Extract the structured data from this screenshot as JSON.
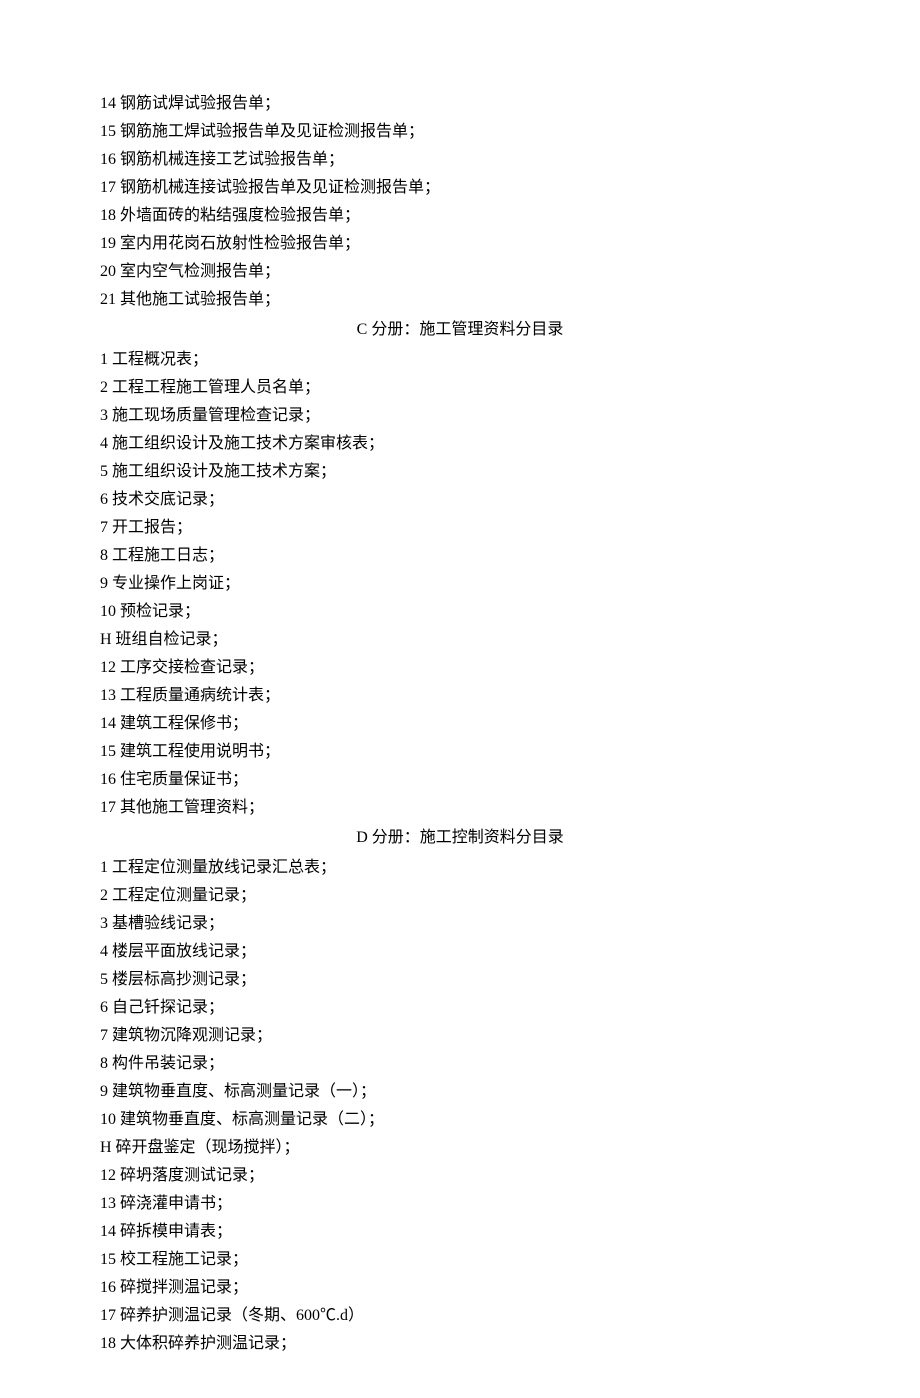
{
  "sectionB_tail": [
    "14 钢筋试焊试验报告单；",
    "15 钢筋施工焊试验报告单及见证检测报告单；",
    "16 钢筋机械连接工艺试验报告单；",
    "17 钢筋机械连接试验报告单及见证检测报告单；",
    "18 外墙面砖的粘结强度检验报告单；",
    "19 室内用花岗石放射性检验报告单；",
    "20 室内空气检测报告单；",
    "21 其他施工试验报告单；"
  ],
  "sectionC": {
    "header": "C 分册：施工管理资料分目录",
    "items": [
      "1 工程概况表；",
      "2 工程工程施工管理人员名单；",
      "3 施工现场质量管理检查记录；",
      "4 施工组织设计及施工技术方案审核表；",
      "5 施工组织设计及施工技术方案；",
      "6 技术交底记录；",
      "7 开工报告；",
      "8 工程施工日志；",
      "9 专业操作上岗证；",
      "10 预检记录；",
      "H 班组自检记录；",
      "12 工序交接检查记录；",
      "13 工程质量通病统计表；",
      "14 建筑工程保修书；",
      "15 建筑工程使用说明书；",
      "16 住宅质量保证书；",
      "17 其他施工管理资料；"
    ]
  },
  "sectionD": {
    "header": "D 分册：施工控制资料分目录",
    "items": [
      "1 工程定位测量放线记录汇总表；",
      "2 工程定位测量记录；",
      "3 基槽验线记录；",
      "4 楼层平面放线记录；",
      "5 楼层标高抄测记录；",
      "6 自己钎探记录；",
      "7 建筑物沉降观测记录；",
      "8 构件吊装记录；",
      "9 建筑物垂直度、标高测量记录（一）；",
      "10 建筑物垂直度、标高测量记录（二）；",
      "H 碎开盘鉴定（现场搅拌）；",
      "12 碎坍落度测试记录；",
      "13 碎浇灌申请书；",
      "14 碎拆模申请表；",
      "15 校工程施工记录；",
      "16 碎搅拌测温记录；",
      "17 碎养护测温记录（冬期、600℃.d）",
      "18 大体积碎养护测温记录；"
    ]
  }
}
